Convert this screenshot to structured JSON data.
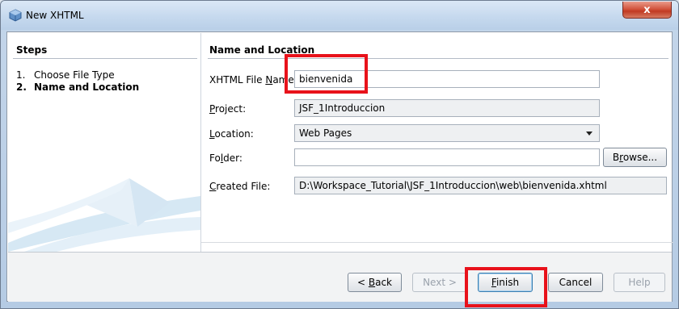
{
  "window": {
    "title": "New XHTML",
    "close_label": "x"
  },
  "steps": {
    "header": "Steps",
    "items": [
      {
        "number": "1.",
        "label": "Choose File Type"
      },
      {
        "number": "2.",
        "label": "Name and Location"
      }
    ]
  },
  "main": {
    "header": "Name and Location",
    "file_name": {
      "label_prefix": "XHTML File ",
      "label_mnemonic": "N",
      "label_suffix": "ame:",
      "value": "bienvenida"
    },
    "project": {
      "label_mnemonic": "P",
      "label_suffix": "roject:",
      "value": "JSF_1Introduccion"
    },
    "location": {
      "label_mnemonic": "L",
      "label_suffix": "ocation:",
      "value": "Web Pages"
    },
    "folder": {
      "label_prefix": "Fo",
      "label_mnemonic": "l",
      "label_suffix": "der:",
      "value": ""
    },
    "browse_button": {
      "label_prefix": "B",
      "label_mnemonic": "r",
      "label_suffix": "owse..."
    },
    "created_file": {
      "label_mnemonic": "C",
      "label_suffix": "reated File:",
      "value": "D:\\Workspace_Tutorial\\JSF_1Introduccion\\web\\bienvenida.xhtml"
    }
  },
  "footer": {
    "back": {
      "prefix": "< ",
      "mnemonic": "B",
      "suffix": "ack"
    },
    "next": "Next >",
    "finish": {
      "mnemonic": "F",
      "suffix": "inish"
    },
    "cancel": "Cancel",
    "help": "Help"
  },
  "colors": {
    "highlight": "#e8121b",
    "title_bar": "#c6d9ee",
    "close_button": "#c13a22"
  }
}
